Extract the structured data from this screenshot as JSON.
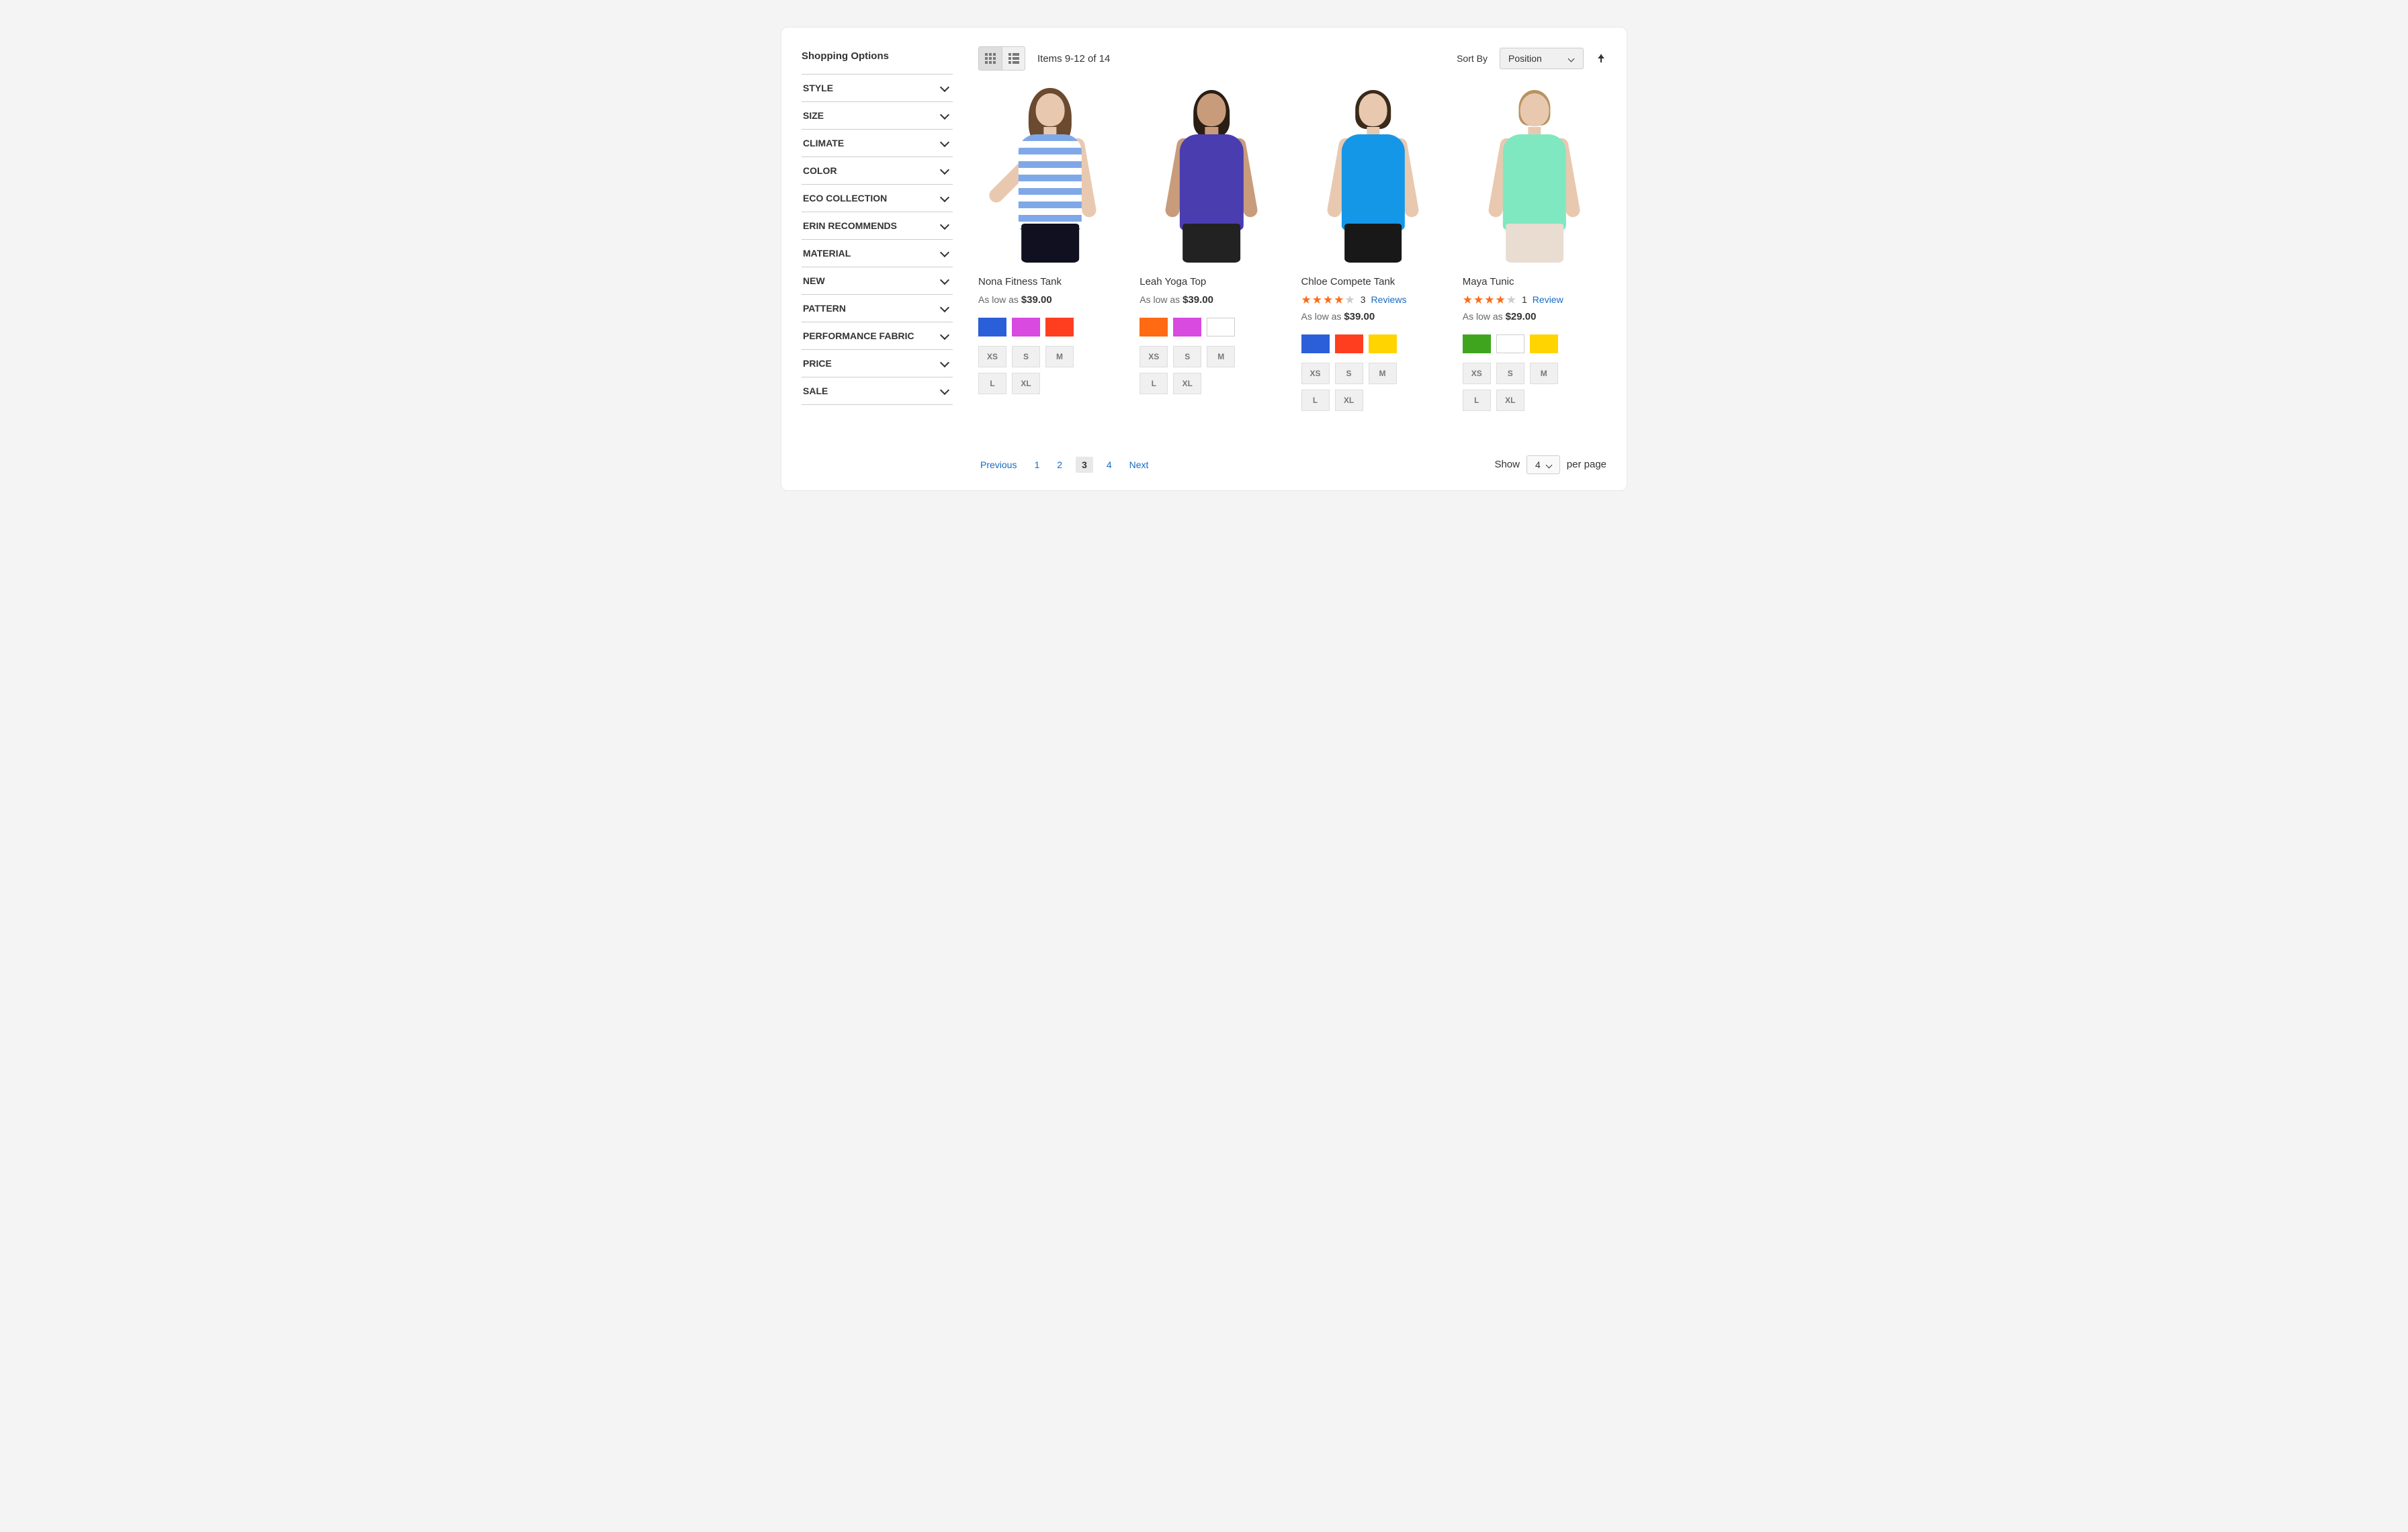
{
  "sidebar": {
    "title": "Shopping Options",
    "filters": [
      "STYLE",
      "SIZE",
      "CLIMATE",
      "COLOR",
      "ECO COLLECTION",
      "ERIN RECOMMENDS",
      "MATERIAL",
      "NEW",
      "PATTERN",
      "PERFORMANCE FABRIC",
      "PRICE",
      "SALE"
    ]
  },
  "toolbar": {
    "items_label": "Items 9-12 of 14",
    "sort_label": "Sort By",
    "sort_value": "Position"
  },
  "products": [
    {
      "name": "Nona Fitness Tank",
      "price_prefix": "As low as ",
      "price": "$39.00",
      "rating": 0,
      "review_count": null,
      "review_word": null,
      "colors": [
        "#2b5fda",
        "#d84ae0",
        "#ff3d1f"
      ],
      "sizes": [
        "XS",
        "S",
        "M",
        "L",
        "XL"
      ]
    },
    {
      "name": "Leah Yoga Top",
      "price_prefix": "As low as ",
      "price": "$39.00",
      "rating": 0,
      "review_count": null,
      "review_word": null,
      "colors": [
        "#ff6a13",
        "#d84ae0",
        "white"
      ],
      "sizes": [
        "XS",
        "S",
        "M",
        "L",
        "XL"
      ]
    },
    {
      "name": "Chloe Compete Tank",
      "price_prefix": "As low as ",
      "price": "$39.00",
      "rating": 4,
      "review_count": "3",
      "review_word": "Reviews",
      "colors": [
        "#2b5fda",
        "#ff3d1f",
        "#ffd400"
      ],
      "sizes": [
        "XS",
        "S",
        "M",
        "L",
        "XL"
      ]
    },
    {
      "name": "Maya Tunic",
      "price_prefix": "As low as ",
      "price": "$29.00",
      "rating": 4,
      "review_count": "1",
      "review_word": "Review",
      "colors": [
        "#3fa51f",
        "white",
        "#ffd400"
      ],
      "sizes": [
        "XS",
        "S",
        "M",
        "L",
        "XL"
      ]
    }
  ],
  "pagination": {
    "prev": "Previous",
    "pages": [
      "1",
      "2",
      "3",
      "4"
    ],
    "current": "3",
    "next": "Next"
  },
  "per_page": {
    "show_label": "Show",
    "value": "4",
    "suffix": "per page"
  }
}
